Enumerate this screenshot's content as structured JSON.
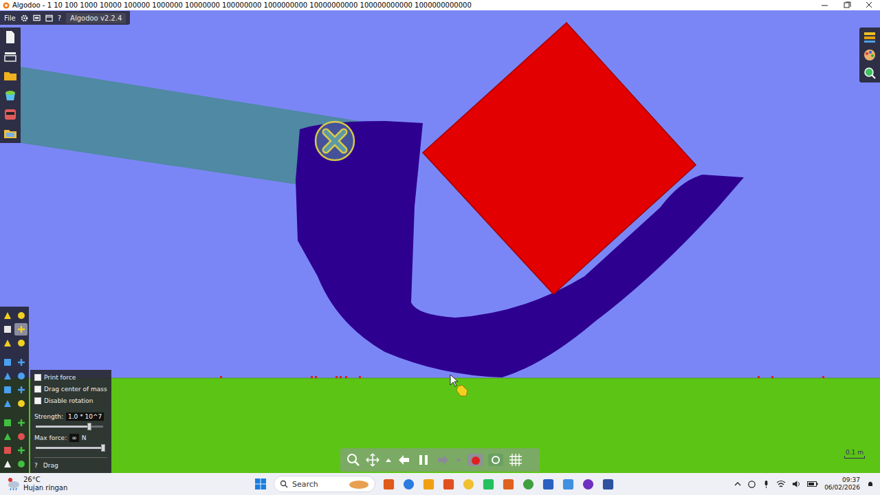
{
  "window": {
    "title": "Algodoo - 1 10 100 1000 10000 100000 1000000 10000000 100000000 1000000000 10000000000 100000000000 1000000000000"
  },
  "menu": {
    "file": "File",
    "help": "?",
    "version": "Algodoo v2.2.4"
  },
  "scene": {
    "shapes": [
      {
        "kind": "beam",
        "color": "#4b8a9c"
      },
      {
        "kind": "ushape",
        "color": "#2e0090"
      },
      {
        "kind": "box",
        "color": "#e20000"
      }
    ]
  },
  "tools": [
    {
      "selected": false
    },
    {
      "selected": false
    },
    {
      "selected": false
    },
    {
      "selected": true
    },
    {
      "selected": false
    },
    {
      "selected": false
    },
    {
      "selected": false
    },
    {
      "selected": false
    },
    {
      "selected": false
    },
    {
      "selected": false
    },
    {
      "selected": false
    },
    {
      "selected": false
    },
    {
      "selected": false
    },
    {
      "selected": false
    },
    {
      "selected": false
    },
    {
      "selected": false
    },
    {
      "selected": false
    },
    {
      "selected": false
    },
    {
      "selected": false
    },
    {
      "selected": false
    },
    {
      "selected": false
    },
    {
      "selected": false
    }
  ],
  "drag_panel": {
    "options": [
      {
        "label": "Print force",
        "checked": false
      },
      {
        "label": "Drag center of mass",
        "checked": false
      },
      {
        "label": "Disable rotation",
        "checked": false
      }
    ],
    "strength": {
      "label": "Strength:",
      "value": "1.0 * 10^7",
      "level": 0.8
    },
    "max_force": {
      "label": "Max force:",
      "value": "∞",
      "unit": "N",
      "level": 1.0
    },
    "help": "?",
    "tool": "Drag"
  },
  "simulation": {
    "running": true
  },
  "scale": "0.1 m",
  "taskbar": {
    "weather": {
      "temp": "26°C",
      "desc": "Hujan ringan"
    },
    "search": "Search",
    "clock": {
      "time": "09:37",
      "date": "06/02/2026"
    }
  }
}
